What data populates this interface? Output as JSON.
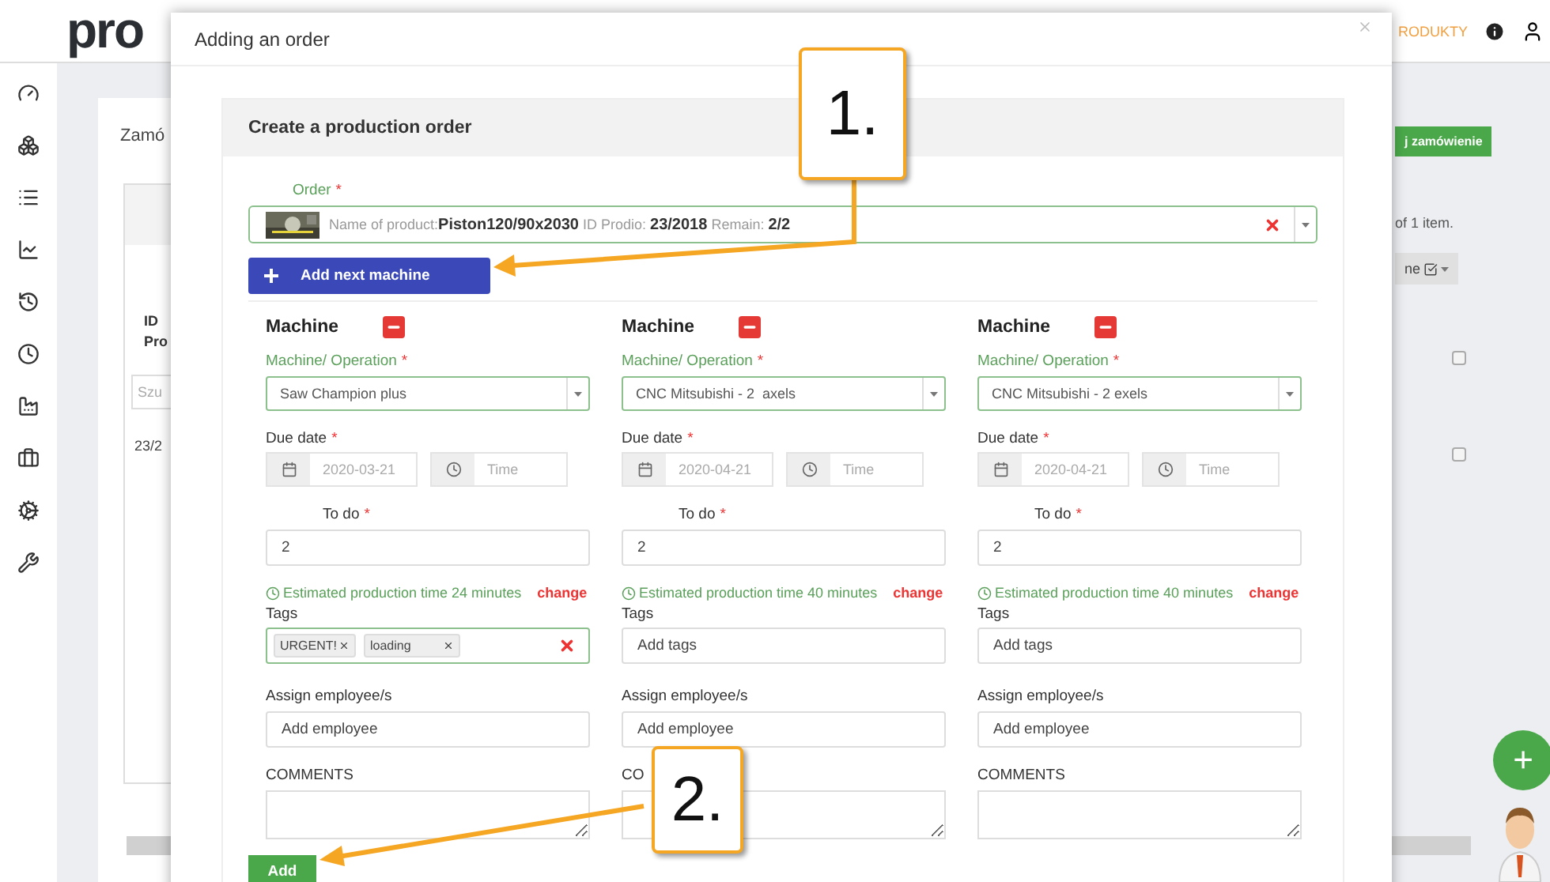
{
  "header": {
    "logo": "pro",
    "nav_link": "RODUKTY"
  },
  "background": {
    "title": "Zamó",
    "create_button": "j zamówienie",
    "table_header": [
      "ID",
      "Pro"
    ],
    "search_placeholder": "Szu",
    "row_id": "23/2",
    "summary": "of 1 item.",
    "columns_button": "ne",
    "row_checkboxes": [
      {
        "checked": false
      },
      {
        "checked": false
      }
    ]
  },
  "required_mark": "*",
  "modal": {
    "title": "Adding an order",
    "panel_title": "Create a production order",
    "order": {
      "label": "Order",
      "required": true,
      "value": "Name of product:**Piston120/90x2030** ID Prodio: **23/2018**  Remain: **2/2**"
    },
    "add_machine_button": "Add next machine",
    "machines": [
      {
        "title": "Machine",
        "operation": {
          "label": "Machine/ Operation",
          "required": true,
          "value": "Saw Champion plus"
        },
        "due_date": {
          "label": "Due date",
          "required": true,
          "date": "2020-03-21",
          "time_placeholder": "Time"
        },
        "todo": {
          "label": "To do",
          "required": true,
          "value": "2"
        },
        "estimate": "Estimated production time 24 minutes",
        "change_link": "change",
        "tags": {
          "label": "Tags",
          "items": [
            {
              "label": "URGENT!"
            },
            {
              "label": "loading"
            }
          ]
        },
        "employee": {
          "label": "Assign employee/s",
          "placeholder": "Add employee"
        },
        "comments_label": "COMMENTS"
      },
      {
        "title": "Machine",
        "operation": {
          "label": "Machine/ Operation",
          "required": true,
          "value": "CNC Mitsubishi - 2  axels"
        },
        "due_date": {
          "label": "Due date",
          "required": true,
          "date": "2020-04-21",
          "time_placeholder": "Time"
        },
        "todo": {
          "label": "To do",
          "required": true,
          "value": "2"
        },
        "estimate": "Estimated production time 40 minutes",
        "change_link": "change",
        "tags": {
          "label": "Tags",
          "placeholder": "Add tags"
        },
        "employee": {
          "label": "Assign employee/s",
          "placeholder": "Add employee"
        },
        "comments_label": "CO"
      },
      {
        "title": "Machine",
        "operation": {
          "label": "Machine/ Operation",
          "required": true,
          "value": "CNC Mitsubishi - 2 exels"
        },
        "due_date": {
          "label": "Due date",
          "required": true,
          "date": "2020-04-21",
          "time_placeholder": "Time"
        },
        "todo": {
          "label": "To do",
          "required": true,
          "value": "2"
        },
        "estimate": "Estimated production time 40 minutes",
        "change_link": "change",
        "tags": {
          "label": "Tags",
          "placeholder": "Add tags"
        },
        "employee": {
          "label": "Assign employee/s",
          "placeholder": "Add employee"
        },
        "comments_label": "COMMENTS"
      }
    ],
    "submit_button": "Add"
  },
  "callouts": [
    {
      "label": "1."
    },
    {
      "label": "2."
    }
  ],
  "fab": "+"
}
